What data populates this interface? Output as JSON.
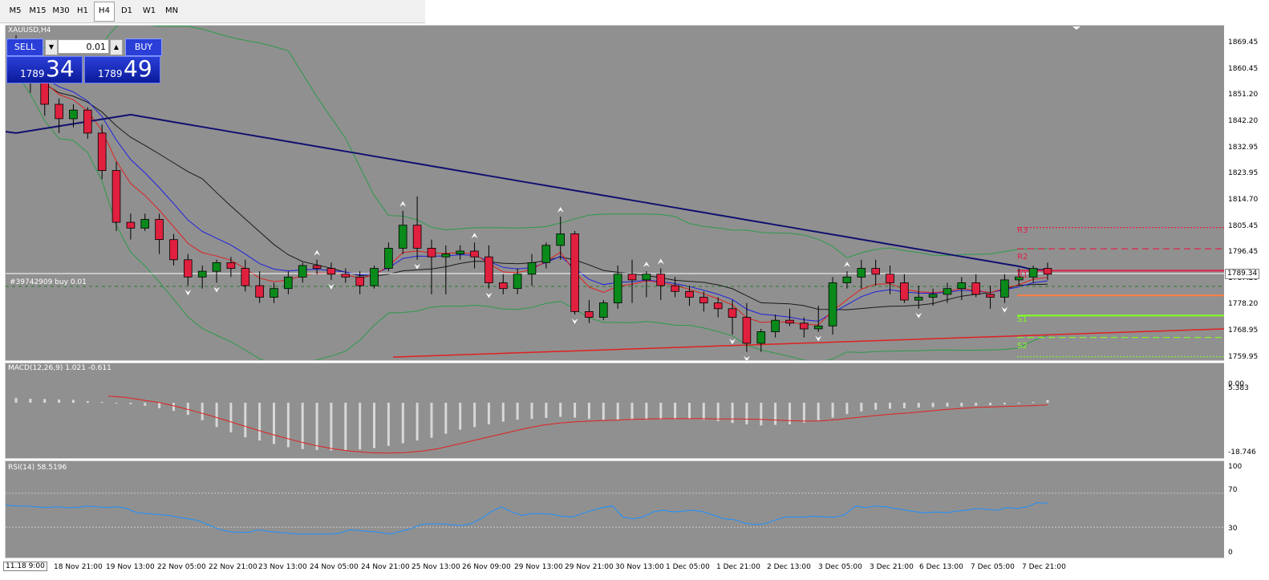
{
  "timeframes": [
    "M5",
    "M15",
    "M30",
    "H1",
    "H4",
    "D1",
    "W1",
    "MN"
  ],
  "active_timeframe": "H4",
  "chart": {
    "symbol_title": "XAUUSD,H4",
    "trade_line_label": "#39742909 buy 0.01",
    "current_price": "1789.34",
    "price_axis": [
      "1869.45",
      "1860.45",
      "1851.20",
      "1842.20",
      "1832.95",
      "1823.95",
      "1814.70",
      "1805.45",
      "1796.45",
      "1787.20",
      "1778.20",
      "1768.95",
      "1759.95"
    ],
    "pivots": [
      {
        "label": "R3",
        "price": 1805.2,
        "color": "#e0204a",
        "style": "dotted"
      },
      {
        "label": "R2",
        "price": 1797.8,
        "color": "#e0204a",
        "style": "dashed"
      },
      {
        "label": "R1",
        "price": 1790.2,
        "color": "#e0204a",
        "style": "solid"
      },
      {
        "label": "S1",
        "price": 1774.6,
        "color": "#80ff20",
        "style": "solid"
      },
      {
        "label": "S2",
        "price": 1767.0,
        "color": "#80ff20",
        "style": "dashed"
      }
    ],
    "pivot_line_price": 1781.6,
    "x_axis_first": "11.18 9:00",
    "x_axis": [
      "18 Nov 21:00",
      "19 Nov 13:00",
      "22 Nov 05:00",
      "22 Nov 21:00",
      "23 Nov 13:00",
      "24 Nov 05:00",
      "24 Nov 21:00",
      "25 Nov 13:00",
      "26 Nov 09:00",
      "29 Nov 13:00",
      "29 Nov 21:00",
      "30 Nov 13:00",
      "1 Dec 05:00",
      "1 Dec 21:00",
      "2 Dec 13:00",
      "3 Dec 05:00",
      "3 Dec 21:00",
      "6 Dec 13:00",
      "7 Dec 05:00",
      "7 Dec 21:00"
    ]
  },
  "trade_panel": {
    "sell_label": "SELL",
    "buy_label": "BUY",
    "lot": "0.01",
    "sell_small": "1789",
    "sell_big": "34",
    "buy_small": "1789",
    "buy_big": "49",
    "down_arrow": "▼",
    "up_arrow": "▲"
  },
  "macd": {
    "label": "MACD(12,26,9) 1.021 -0.611",
    "axis": [
      "5.383",
      "0.00",
      "-18.746"
    ]
  },
  "rsi": {
    "label": "RSI(14) 58.5196",
    "axis": [
      "100",
      "70",
      "30",
      "0"
    ]
  },
  "chart_data": {
    "type": "candlestick",
    "title": "XAUUSD,H4",
    "candles": [
      [
        1870,
        1872,
        1858,
        1861
      ],
      [
        1861,
        1864,
        1852,
        1856
      ],
      [
        1856,
        1858,
        1844,
        1848
      ],
      [
        1848,
        1850,
        1838,
        1843
      ],
      [
        1843,
        1848,
        1840,
        1846
      ],
      [
        1846,
        1847,
        1836,
        1838
      ],
      [
        1838,
        1841,
        1822,
        1825
      ],
      [
        1825,
        1828,
        1804,
        1807
      ],
      [
        1807,
        1810,
        1801,
        1805
      ],
      [
        1805,
        1810,
        1804,
        1808
      ],
      [
        1808,
        1810,
        1796,
        1801
      ],
      [
        1801,
        1803,
        1792,
        1794
      ],
      [
        1794,
        1796,
        1785,
        1788
      ],
      [
        1788,
        1792,
        1784,
        1790
      ],
      [
        1790,
        1794,
        1786,
        1793
      ],
      [
        1793,
        1795,
        1788,
        1791
      ],
      [
        1791,
        1794,
        1783,
        1785
      ],
      [
        1785,
        1790,
        1779,
        1781
      ],
      [
        1781,
        1786,
        1779,
        1784
      ],
      [
        1784,
        1790,
        1782,
        1788
      ],
      [
        1788,
        1793,
        1786,
        1792
      ],
      [
        1792,
        1794,
        1789,
        1791
      ],
      [
        1791,
        1793,
        1787,
        1789
      ],
      [
        1789,
        1791,
        1786,
        1788
      ],
      [
        1788,
        1790,
        1782,
        1785
      ],
      [
        1785,
        1792,
        1784,
        1791
      ],
      [
        1791,
        1800,
        1790,
        1798
      ],
      [
        1798,
        1811,
        1796,
        1806
      ],
      [
        1806,
        1816,
        1794,
        1798
      ],
      [
        1798,
        1801,
        1782,
        1795
      ],
      [
        1795,
        1799,
        1782,
        1796
      ],
      [
        1796,
        1799,
        1794,
        1797
      ],
      [
        1797,
        1800,
        1791,
        1795
      ],
      [
        1795,
        1799,
        1784,
        1786
      ],
      [
        1786,
        1789,
        1782,
        1784
      ],
      [
        1784,
        1791,
        1782,
        1789
      ],
      [
        1789,
        1796,
        1785,
        1793
      ],
      [
        1793,
        1800,
        1791,
        1799
      ],
      [
        1799,
        1809,
        1794,
        1803
      ],
      [
        1803,
        1804,
        1775,
        1776
      ],
      [
        1776,
        1780,
        1772,
        1774
      ],
      [
        1774,
        1780,
        1773,
        1779
      ],
      [
        1779,
        1792,
        1777,
        1789
      ],
      [
        1789,
        1794,
        1779,
        1787
      ],
      [
        1787,
        1790,
        1781,
        1789
      ],
      [
        1789,
        1791,
        1780,
        1785
      ],
      [
        1785,
        1788,
        1781,
        1783
      ],
      [
        1783,
        1785,
        1778,
        1781
      ],
      [
        1781,
        1783,
        1776,
        1779
      ],
      [
        1779,
        1781,
        1774,
        1777
      ],
      [
        1777,
        1780,
        1768,
        1774
      ],
      [
        1774,
        1779,
        1762,
        1765
      ],
      [
        1765,
        1770,
        1762,
        1769
      ],
      [
        1769,
        1775,
        1767,
        1773
      ],
      [
        1773,
        1777,
        1771,
        1772
      ],
      [
        1772,
        1774,
        1767,
        1770
      ],
      [
        1770,
        1778,
        1769,
        1771
      ],
      [
        1771,
        1788,
        1768,
        1786
      ],
      [
        1786,
        1790,
        1784,
        1788
      ],
      [
        1788,
        1794,
        1784,
        1791
      ],
      [
        1791,
        1794,
        1785,
        1789
      ],
      [
        1789,
        1792,
        1782,
        1786
      ],
      [
        1786,
        1789,
        1779,
        1780
      ],
      [
        1780,
        1785,
        1777,
        1781
      ],
      [
        1781,
        1784,
        1778,
        1782
      ],
      [
        1782,
        1786,
        1779,
        1784
      ],
      [
        1784,
        1788,
        1780,
        1786
      ],
      [
        1786,
        1789,
        1781,
        1782
      ],
      [
        1782,
        1785,
        1777,
        1781
      ],
      [
        1781,
        1789,
        1779,
        1787
      ],
      [
        1787,
        1791,
        1785,
        1788
      ],
      [
        1788,
        1792,
        1786,
        1791
      ],
      [
        1791,
        1793,
        1787,
        1789
      ]
    ],
    "macd_hist": [
      1.8,
      1.5,
      1.4,
      1.2,
      1.1,
      0.6,
      0.3,
      0.0,
      -0.5,
      -1.1,
      -2.0,
      -3.0,
      -4.5,
      -6.5,
      -9.0,
      -11.0,
      -12.8,
      -14.0,
      -15.3,
      -16.5,
      -17.2,
      -17.5,
      -17.7,
      -17.6,
      -17.3,
      -16.8,
      -16.0,
      -15.0,
      -14.0,
      -13.0,
      -11.5,
      -10.0,
      -9.0,
      -8.0,
      -7.0,
      -6.3,
      -6.0,
      -5.6,
      -5.2,
      -5.5,
      -6.0,
      -6.3,
      -6.2,
      -6.3,
      -6.3,
      -6.2,
      -6.1,
      -6.0,
      -6.3,
      -6.8,
      -7.5,
      -8.0,
      -8.4,
      -8.2,
      -8.0,
      -7.4,
      -6.5,
      -5.5,
      -4.2,
      -3.2,
      -2.6,
      -2.2,
      -2.0,
      -1.8,
      -1.6,
      -1.4,
      -1.3,
      -1.1,
      -0.9,
      -0.6,
      -0.2,
      0.3,
      1.0
    ],
    "macd_signal": [
      2.5,
      2.0,
      1.0,
      0.0,
      -1.5,
      -3.2,
      -5.0,
      -7.0,
      -9.0,
      -11.0,
      -12.8,
      -14.5,
      -16.0,
      -17.2,
      -18.0,
      -18.5,
      -18.7,
      -18.5,
      -18.0,
      -17.0,
      -15.5,
      -14.0,
      -12.5,
      -11.0,
      -9.5,
      -8.3,
      -7.5,
      -7.0,
      -6.7,
      -6.5,
      -6.2,
      -6.0,
      -5.9,
      -5.9,
      -5.9,
      -6.0,
      -6.0,
      -6.1,
      -6.3,
      -6.6,
      -6.8,
      -6.7,
      -6.2,
      -5.5,
      -4.8,
      -4.2,
      -3.8,
      -3.2,
      -2.6,
      -2.1,
      -1.7,
      -1.5,
      -1.3,
      -1.1,
      -0.8
    ],
    "rsi": [
      56,
      55,
      55,
      54,
      53,
      54,
      53,
      53,
      55,
      54,
      53,
      54,
      52,
      47,
      46,
      45,
      44,
      42,
      40,
      38,
      33,
      28,
      25,
      24,
      24,
      27,
      25,
      24,
      23,
      22,
      22,
      22,
      22,
      23,
      27,
      26,
      25,
      24,
      22,
      25,
      28,
      33,
      34,
      34,
      33,
      32,
      34,
      40,
      48,
      54,
      48,
      44,
      46,
      46,
      45,
      43,
      42,
      46,
      50,
      53,
      55,
      42,
      40,
      42,
      48,
      50,
      48,
      49,
      50,
      48,
      44,
      40,
      39,
      35,
      33,
      34,
      38,
      42,
      42,
      42,
      43,
      42,
      42,
      45,
      55,
      53,
      55,
      54,
      52,
      50,
      48,
      47,
      48,
      47,
      49,
      50,
      52,
      51,
      50,
      53,
      52,
      54,
      59,
      58
    ]
  }
}
